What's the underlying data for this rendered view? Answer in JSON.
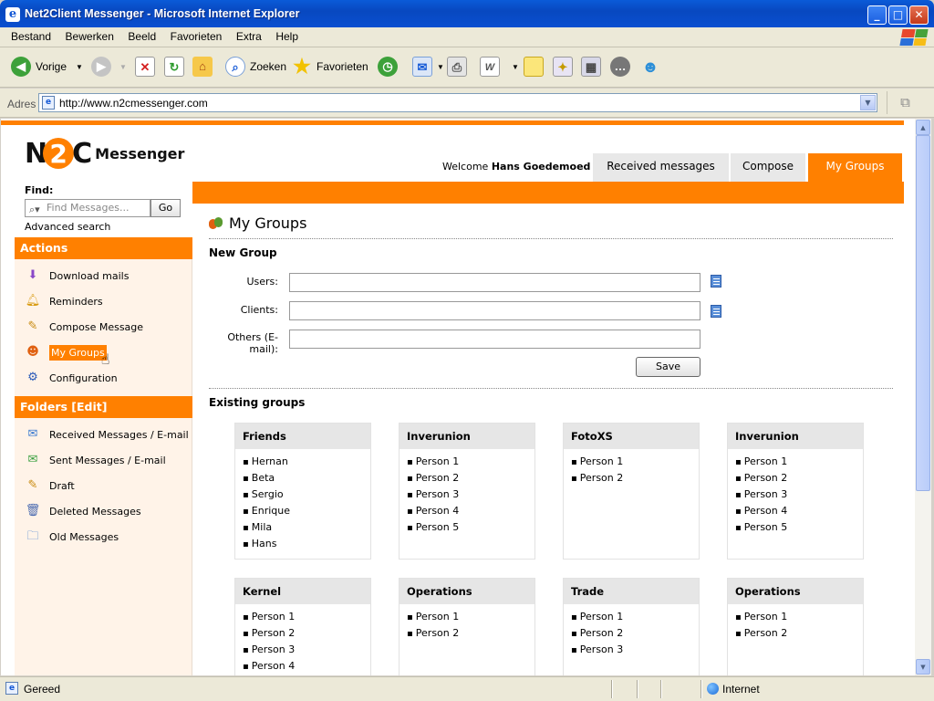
{
  "window": {
    "title": "Net2Client Messenger - Microsoft Internet Explorer"
  },
  "menu": [
    "Bestand",
    "Bewerken",
    "Beeld",
    "Favorieten",
    "Extra",
    "Help"
  ],
  "toolbar": {
    "back_label": "Vorige",
    "search_label": "Zoeken",
    "favorites_label": "Favorieten"
  },
  "address": {
    "label": "Adres",
    "url": "http://www.n2cmessenger.com"
  },
  "logo": {
    "mark": "N2C",
    "brand": "Messenger"
  },
  "header": {
    "welcome_prefix": "Welcome",
    "user_name": "Hans Goedemoed",
    "tabs": [
      "Received messages",
      "Compose",
      "My Groups"
    ],
    "active_tab": "My Groups"
  },
  "sidebar": {
    "find_label": "Find:",
    "search_placeholder": "Find Messages...",
    "go_label": "Go",
    "advanced_search": "Advanced search",
    "actions_header": "Actions",
    "actions": [
      {
        "label": "Download mails",
        "icon": "download-icon"
      },
      {
        "label": "Reminders",
        "icon": "bell-icon"
      },
      {
        "label": "Compose Message",
        "icon": "pencil-icon"
      },
      {
        "label": "My Groups",
        "icon": "groups-icon"
      },
      {
        "label": "Configuration",
        "icon": "gear-icon"
      }
    ],
    "folders_header": "Folders [Edit]",
    "folders": [
      {
        "label": "Received Messages / E-mail",
        "icon": "inbox-icon"
      },
      {
        "label": "Sent Messages / E-mail",
        "icon": "sent-icon"
      },
      {
        "label": "Draft",
        "icon": "draft-icon"
      },
      {
        "label": "Deleted Messages",
        "icon": "trash-icon"
      },
      {
        "label": "Old Messages",
        "icon": "archive-icon"
      }
    ]
  },
  "main": {
    "title": "My Groups",
    "new_group_header": "New Group",
    "fields": [
      {
        "label": "Users:",
        "value": ""
      },
      {
        "label": "Clients:",
        "value": ""
      },
      {
        "label": "Others (E-mail):",
        "value": ""
      }
    ],
    "save_label": "Save",
    "existing_header": "Existing groups",
    "groups": [
      {
        "name": "Friends",
        "members": [
          "Hernan",
          "Beta",
          "Sergio",
          "Enrique",
          "Mila",
          "Hans"
        ]
      },
      {
        "name": "Inverunion",
        "members": [
          "Person 1",
          "Person 2",
          "Person 3",
          "Person 4",
          "Person 5"
        ]
      },
      {
        "name": "FotoXS",
        "members": [
          "Person 1",
          "Person 2"
        ]
      },
      {
        "name": "Inverunion",
        "members": [
          "Person 1",
          "Person 2",
          "Person 3",
          "Person 4",
          "Person 5"
        ]
      },
      {
        "name": "Kernel",
        "members": [
          "Person 1",
          "Person 2",
          "Person 3",
          "Person 4"
        ]
      },
      {
        "name": "Operations",
        "members": [
          "Person 1",
          "Person 2"
        ]
      },
      {
        "name": "Trade",
        "members": [
          "Person 1",
          "Person 2",
          "Person 3"
        ]
      },
      {
        "name": "Operations",
        "members": [
          "Person 1",
          "Person 2"
        ]
      }
    ]
  },
  "status": {
    "text": "Gereed",
    "zone": "Internet"
  },
  "colors": {
    "accent": "#ff8000",
    "sidebar_bg": "#fff3e8",
    "tab_bg": "#e8e8e8",
    "xp_blue": "#0a5bd8"
  }
}
